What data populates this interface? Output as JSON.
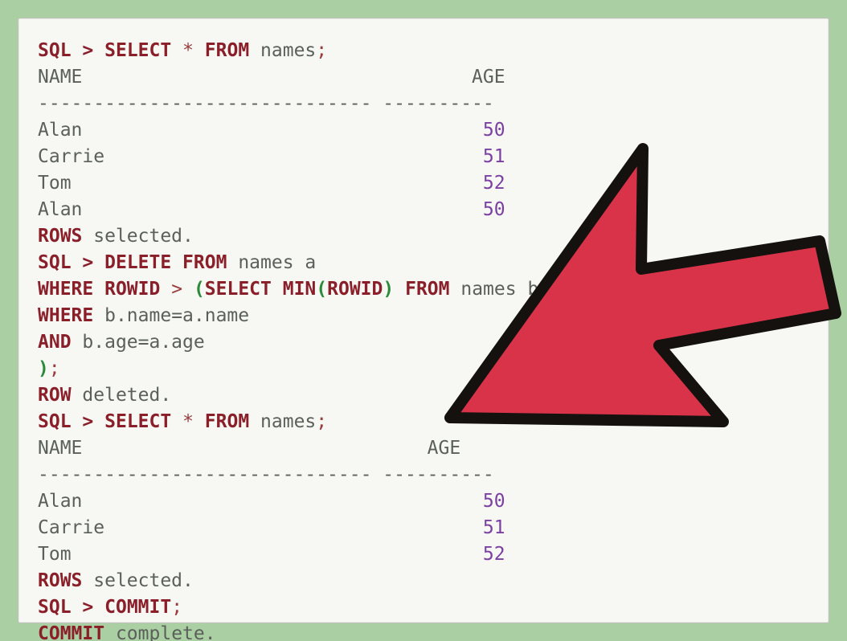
{
  "sql": {
    "prompt": "SQL",
    "gt": ">",
    "select_kw": "SELECT",
    "star": "*",
    "from_kw": "FROM",
    "names_id": "names",
    "names_a": "names a",
    "names_b": "names b",
    "semicolon": ";",
    "delete_kw": "DELETE FROM",
    "where_kw": "WHERE",
    "rowid_kw": "ROWID",
    "gt_op": ">",
    "select_min": "SELECT MIN",
    "min_arg": "ROWID",
    "and_kw": "AND",
    "bname": "b.name=a.name",
    "bage": "b.age=a.age",
    "row_kw": "ROW",
    "rows_kw": "ROWS",
    "selected": "selected.",
    "deleted": "deleted.",
    "commit_kw": "COMMIT",
    "complete": "complete.",
    "lparen": "(",
    "rparen": ")"
  },
  "table": {
    "header_name": "NAME",
    "header_age": "AGE",
    "divider": "------------------------------ ----------",
    "rows_before": [
      {
        "name": "Alan",
        "age": "50"
      },
      {
        "name": "Carrie",
        "age": "51"
      },
      {
        "name": "Tom",
        "age": "52"
      },
      {
        "name": "Alan",
        "age": "50"
      }
    ],
    "rows_after": [
      {
        "name": "Alan",
        "age": "50"
      },
      {
        "name": "Carrie",
        "age": "51"
      },
      {
        "name": "Tom",
        "age": "52"
      }
    ]
  },
  "arrow": {
    "color": "#d9334a",
    "stroke": "#14110f"
  }
}
